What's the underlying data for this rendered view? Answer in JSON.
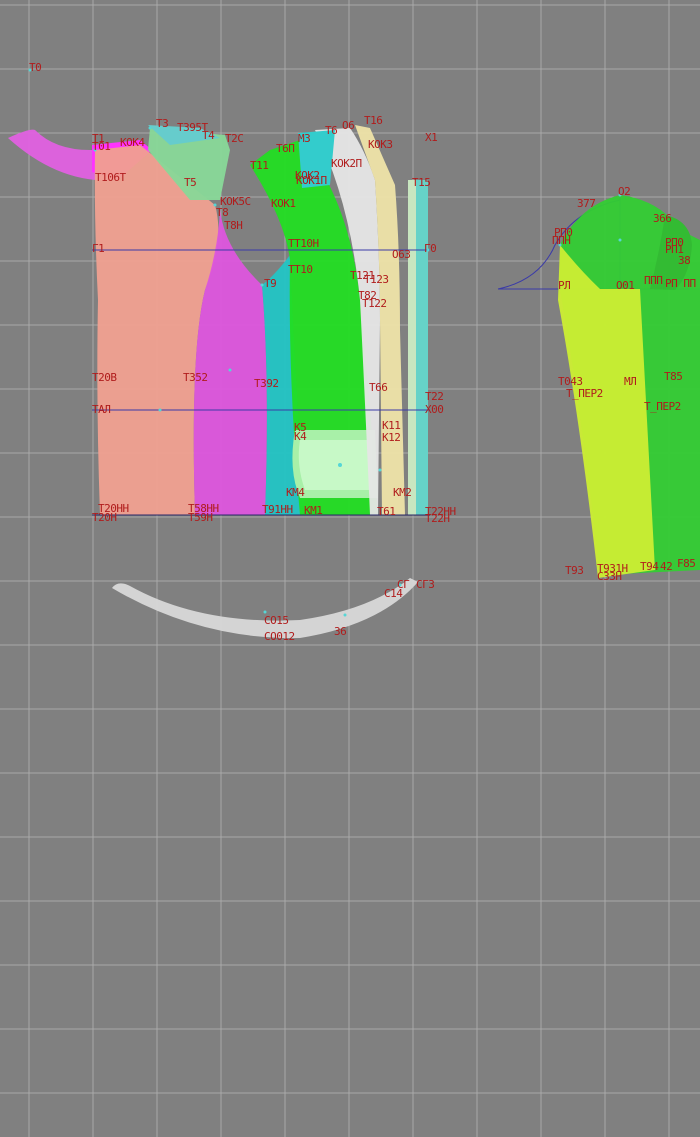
{
  "colors": {
    "background": "#808080",
    "grid": "#a9a9a9",
    "label": "#b01c1c",
    "construction_line": "#3a3aa8",
    "dot": "#56d6d6"
  },
  "labels": {
    "origin": "T0",
    "l_t1": "T1",
    "l_t101": "T01",
    "l_kok4": "KOK4",
    "l_t3": "T3",
    "l_t395": "T395T",
    "l_t4": "T4",
    "l_t2c": "T2C",
    "l_m3": "M3",
    "l_t6p": "T6П",
    "l_t6": "T6",
    "l_o6": "O6",
    "l_t16": "T16",
    "l_kok3": "KOK3",
    "l_x1": "X1",
    "l_t106t": "T106T",
    "l_t5": "T5",
    "l_t11": "T11",
    "l_kok2p": "KOK2П",
    "l_kok1p": "KOK1П",
    "l_kok2": "KOK2",
    "l_t15": "T15",
    "l_kok5c": "KOK5C",
    "l_kok1": "KOK1",
    "l_t8": "T8",
    "l_t8h": "T8H",
    "l_g1": "Г1",
    "l_tt10h": "TT10H",
    "l_o63": "O63",
    "l_g0": "Г0",
    "l_tt10": "TT10",
    "l_t9": "T9",
    "l_t121": "T121",
    "l_t123": "T123",
    "l_t82": "T82",
    "l_t122": "T122",
    "l_t20b": "T20B",
    "l_t352": "T352",
    "l_t392": "T392",
    "l_t66": "T66",
    "l_t22": "T22",
    "l_tal": "TAЛ",
    "l_x00": "X00",
    "l_k5": "K5",
    "l_k4": "K4",
    "l_k11": "K11",
    "l_k12": "K12",
    "l_km4": "KM4",
    "l_km2": "KM2",
    "l_t20hh": "T20HH",
    "l_t20h": "T20H",
    "l_t58hh": "T58HH",
    "l_t59h": "T59H",
    "l_t91hh": "T91HH",
    "l_km1": "KM1",
    "l_t61": "T61",
    "l_t22hh": "T22HH",
    "l_t22h": "T22H",
    "l_o2": "O2",
    "l_377": "377",
    "l_366": "366",
    "l_ppn": "PП0",
    "l_ppn2": "ППН",
    "l_pp0": "PП0",
    "l_pp1": "PП1",
    "l_38": "38",
    "l_pl": "PЛ",
    "l_o0": "O01",
    "l_ppp": "ППП",
    "l_rpp": "PП ПП",
    "l_t043": "T043",
    "l_ml": "МЛ",
    "l_t85": "T85",
    "l_t_per2": "T_ПЕР2",
    "l_t_per": "T_ПЕР2",
    "l_t93": "T93",
    "l_t93h": "T931H",
    "l_c33h": "C33H",
    "l_t94": "T94",
    "l_42": "42",
    "l_f85": "F85",
    "l_cg3": "CГ3",
    "l_cg": "CГ",
    "l_c14": "C14",
    "l_co15": "CO15",
    "l_co12": "CO012",
    "l_36": "36"
  }
}
